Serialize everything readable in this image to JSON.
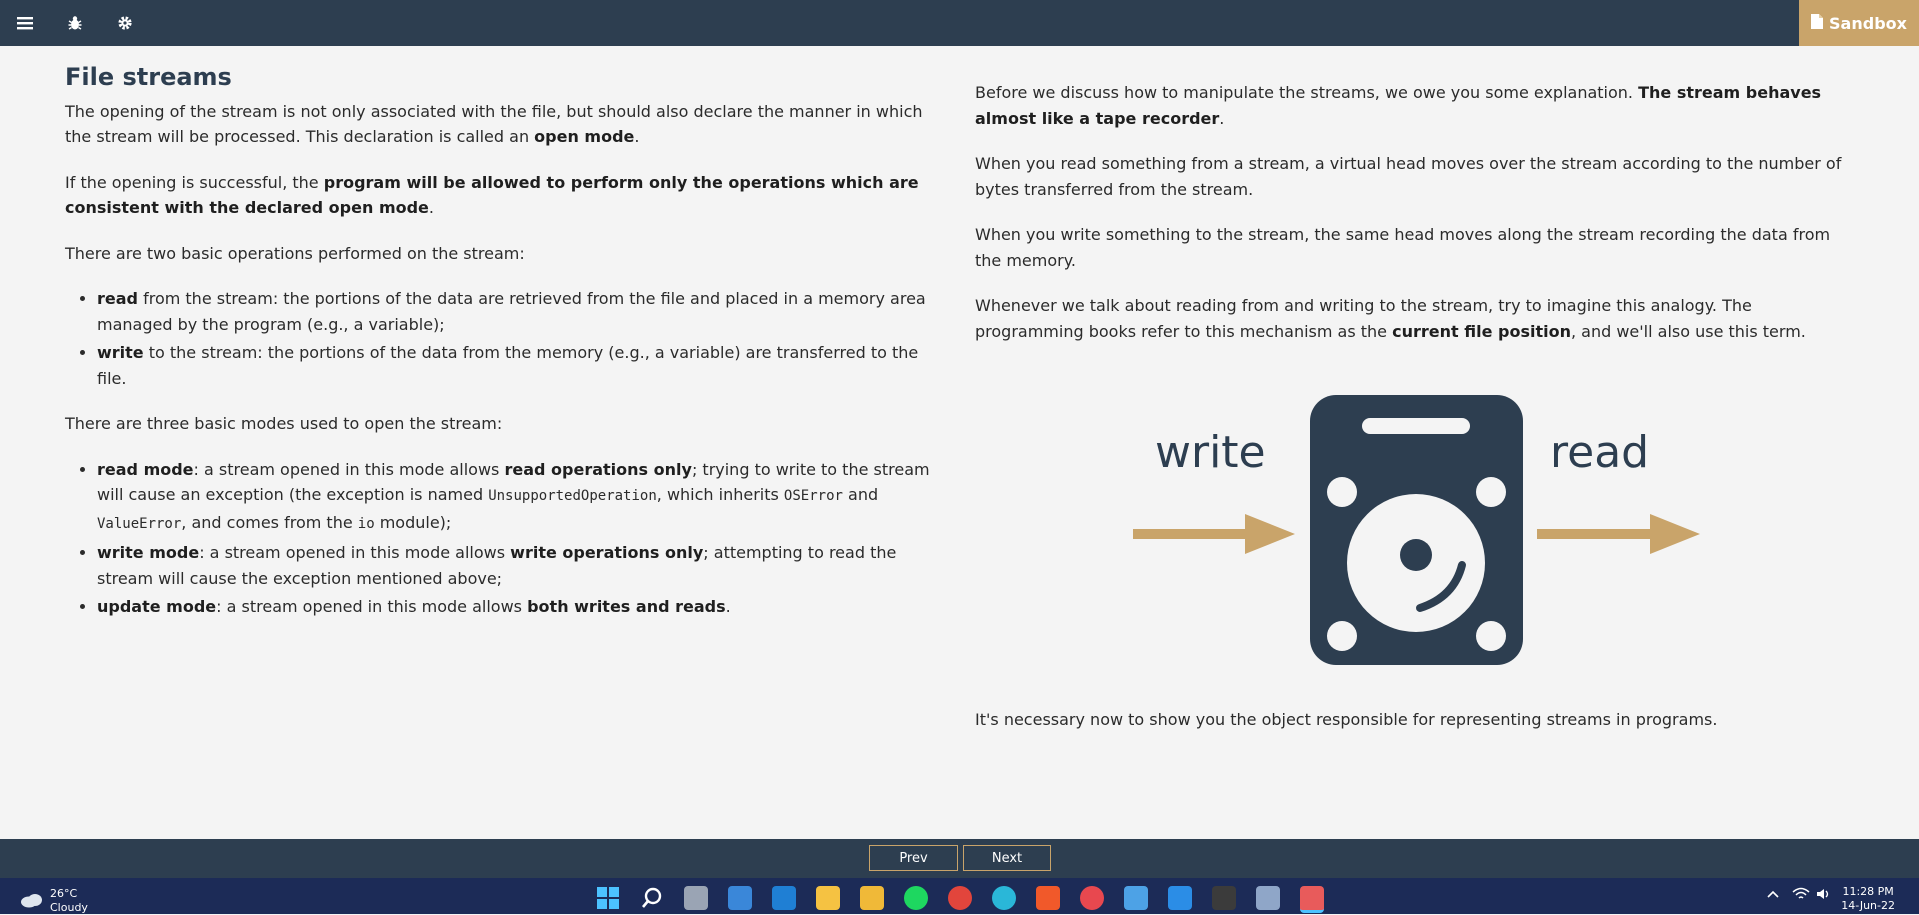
{
  "topbar": {
    "menu_icon": "hamburger-icon",
    "bug_icon": "bug-icon",
    "settings_icon": "gear-icon",
    "sandbox_label": "Sandbox",
    "sandbox_icon": "file-icon",
    "accent": "#c9a46a",
    "bg": "#2d3e50"
  },
  "left": {
    "title": "File streams",
    "p1_a": "The opening of the stream is not only associated with the file, but should also declare the manner in which the stream will be processed. This declaration is called an ",
    "p1_b": "open mode",
    "p1_c": ".",
    "p2_a": "If the opening is successful, the ",
    "p2_b": "program will be allowed to perform only the operations which are consistent with the declared open mode",
    "p2_c": ".",
    "p3": "There are two basic operations performed on the stream:",
    "ops": [
      {
        "b": "read",
        "t": " from the stream: the portions of the data are retrieved from the file and placed in a memory area managed by the program (e.g., a variable);"
      },
      {
        "b": "write",
        "t": " to the stream: the portions of the data from the memory (e.g., a variable) are transferred to the file."
      }
    ],
    "p4": "There are three basic modes used to open the stream:",
    "modes": {
      "read_b": "read mode",
      "read_t1": ": a stream opened in this mode allows ",
      "read_b2": "read operations only",
      "read_t2": "; trying to write to the stream will cause an exception (the exception is named ",
      "read_c1": "UnsupportedOperation",
      "read_t3": ", which inherits ",
      "read_c2": "OSError",
      "read_t4": " and ",
      "read_c3": "ValueError",
      "read_t5": ", and comes from the ",
      "read_c4": "io",
      "read_t6": " module);",
      "write_b": "write mode",
      "write_t1": ": a stream opened in this mode allows ",
      "write_b2": "write operations only",
      "write_t2": "; attempting to read the stream will cause the exception mentioned above;",
      "update_b": "update mode",
      "update_t1": ": a stream opened in this mode allows ",
      "update_b2": "both writes and reads",
      "update_t2": "."
    }
  },
  "right": {
    "p1_a": "Before we discuss how to manipulate the streams, we owe you some explanation. ",
    "p1_b": "The stream behaves almost like a tape recorder",
    "p1_c": ".",
    "p2": "When you read something from a stream, a virtual head moves over the stream according to the number of bytes transferred from the stream.",
    "p3": "When you write something to the stream, the same head moves along the stream recording the data from the memory.",
    "p4_a": "Whenever we talk about reading from and writing to the stream, try to imagine this analogy. The programming books refer to this mechanism as the ",
    "p4_b": "current file position",
    "p4_c": ", and we'll also use this term.",
    "illus_write": "write",
    "illus_read": "read",
    "closing": "It's necessary now to show you the object responsible for representing streams in programs."
  },
  "footer": {
    "prev": "Prev",
    "next": "Next"
  },
  "taskbar": {
    "temp": "26°C",
    "weather": "Cloudy",
    "time": "11:28 PM",
    "date": "14-Jun-22"
  }
}
